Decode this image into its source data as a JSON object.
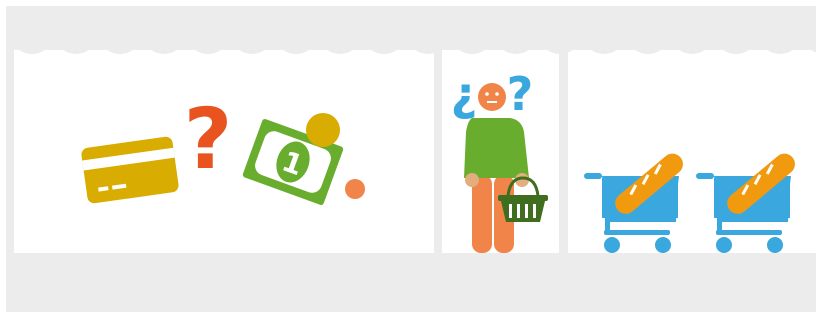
{
  "scene": {
    "panels": [
      "payment-choice",
      "undecided-shopper",
      "shopping-carts"
    ],
    "colors": {
      "frame": "#ececec",
      "panel": "#ffffff",
      "card": "#d8ac00",
      "question_red": "#e8531f",
      "money_green": "#68ad2e",
      "coin": "#d8ac00",
      "dot_orange": "#f08449",
      "question_blue": "#3aa8de",
      "shopper_face": "#f08449",
      "shopper_shirt": "#68ad2e",
      "shopper_legs": "#f08449",
      "hands": "#e2ae7e",
      "basket": "#3f6e1f",
      "cart": "#3aa8de",
      "bread": "#f29a0f"
    }
  },
  "payment": {
    "question_mark": "?",
    "banknote_value": "1"
  },
  "shopper": {
    "inverted_question_mark": "¿",
    "question_mark": "?"
  }
}
